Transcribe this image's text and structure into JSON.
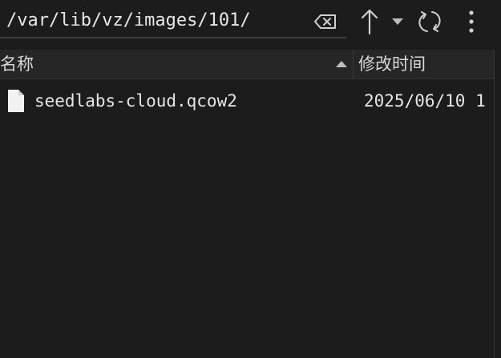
{
  "toolbar": {
    "path_value": "/var/lib/vz/images/101/",
    "icons": {
      "clear": "backspace-clear-icon",
      "up": "arrow-up-icon",
      "history": "chevron-down-icon",
      "refresh": "refresh-icon",
      "menu": "more-vertical-icon"
    }
  },
  "header": {
    "name_label": "名称",
    "date_label": "修改时间",
    "sort": "ascending"
  },
  "files": [
    {
      "name": "seedlabs-cloud.qcow2",
      "modified": "2025/06/10 1",
      "icon": "file-icon"
    }
  ],
  "colors": {
    "background": "#1c1c1c",
    "header_background": "#262626",
    "text": "#e6e6e6"
  }
}
